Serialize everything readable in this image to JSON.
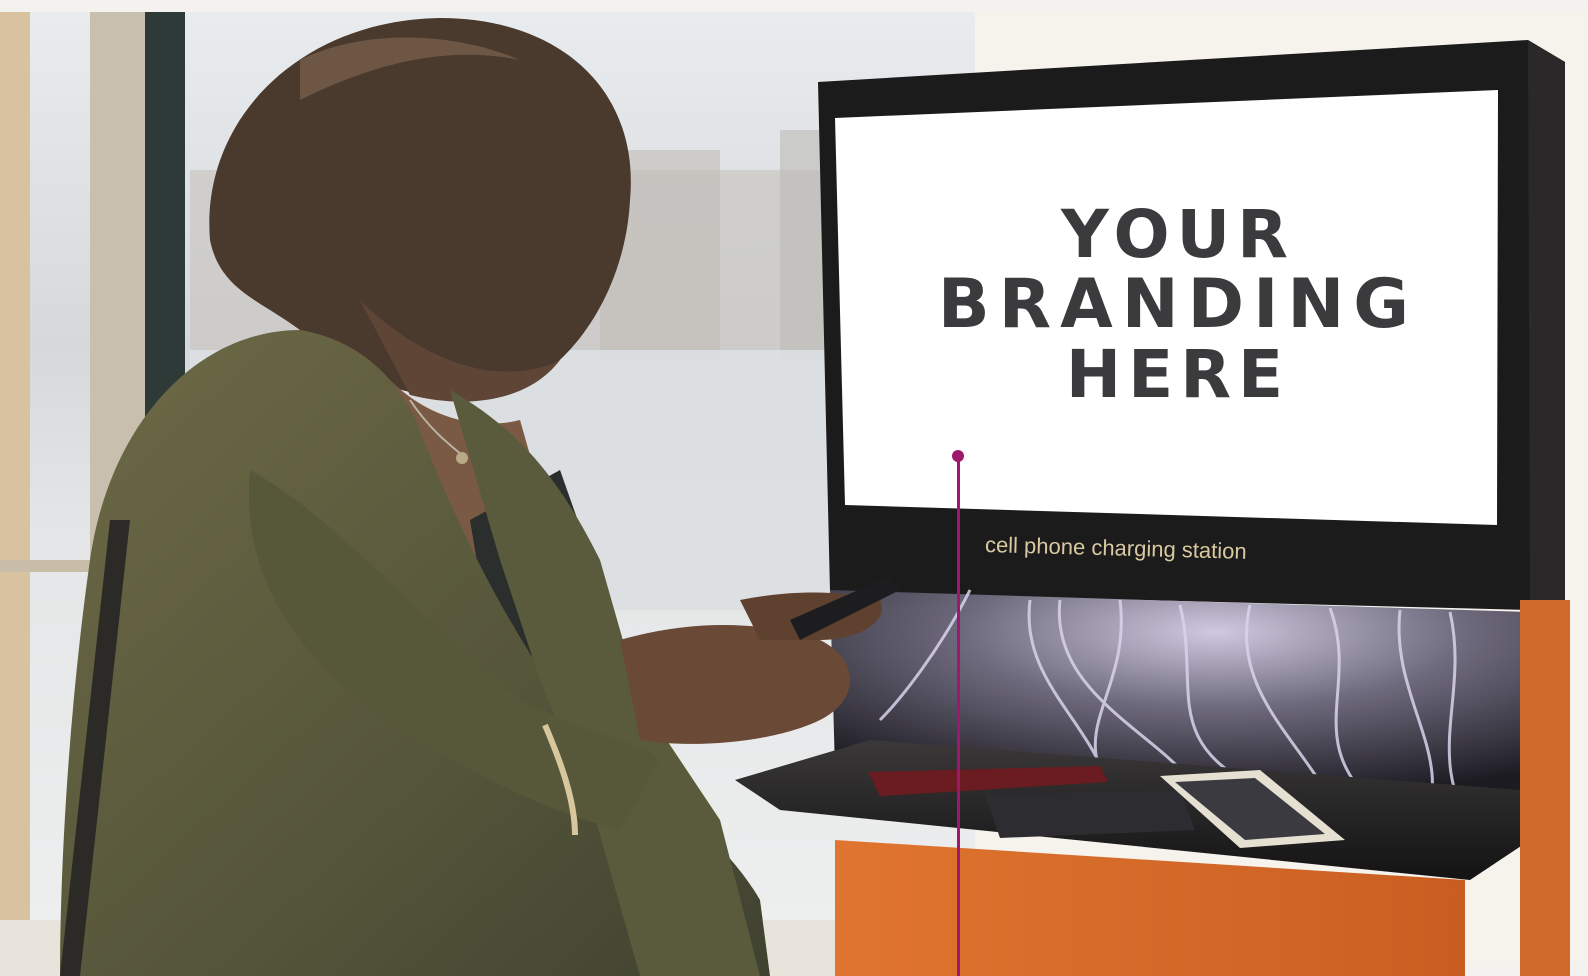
{
  "screen": {
    "lines": [
      "YOUR",
      "BRANDING",
      "HERE"
    ]
  },
  "kiosk_label": "cell phone charging station",
  "colors": {
    "callout": "#a0176e",
    "kiosk_frame": "#1c1b1c",
    "kiosk_base": "#d96a2a",
    "screen_text": "#3b3b3d"
  }
}
